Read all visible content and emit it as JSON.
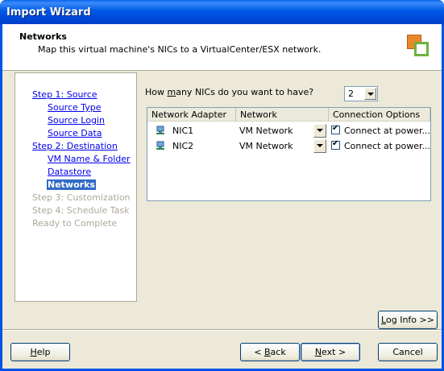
{
  "window": {
    "title": "Import Wizard"
  },
  "header": {
    "title": "Networks",
    "subtitle": "Map this virtual machine's NICs to a VirtualCenter/ESX network."
  },
  "steps": [
    {
      "label": "Step 1: Source",
      "state": "link"
    },
    {
      "label": "Source Type",
      "state": "link"
    },
    {
      "label": "Source Login",
      "state": "link"
    },
    {
      "label": "Source Data",
      "state": "link"
    },
    {
      "label": "Step 2: Destination",
      "state": "link"
    },
    {
      "label": "VM Name & Folder",
      "state": "link"
    },
    {
      "label": "Datastore",
      "state": "link"
    },
    {
      "label": "Networks",
      "state": "current"
    },
    {
      "label": "Step 3: Customization",
      "state": "disabled"
    },
    {
      "label": "Step 4: Schedule Task",
      "state": "disabled"
    },
    {
      "label": "Ready to Complete",
      "state": "disabled"
    }
  ],
  "nic_count": {
    "question_pre": "How ",
    "question_mnemonic": "m",
    "question_post": "any NICs do you want to have?",
    "value": "2"
  },
  "grid": {
    "columns": [
      "Network Adapter",
      "Network",
      "Connection Options"
    ],
    "rows": [
      {
        "adapter": "NIC1",
        "network": "VM Network",
        "connect_label": "Connect at power...",
        "connected": true
      },
      {
        "adapter": "NIC2",
        "network": "VM Network",
        "connect_label": "Connect at power...",
        "connected": true
      }
    ]
  },
  "buttons": {
    "log_info_mnemonic": "L",
    "log_info_rest": "og Info >>",
    "help_mnemonic": "H",
    "help_rest": "elp",
    "back_pre": "< ",
    "back_mnemonic": "B",
    "back_rest": "ack",
    "next_mnemonic": "N",
    "next_rest": "ext >",
    "cancel": "Cancel"
  }
}
